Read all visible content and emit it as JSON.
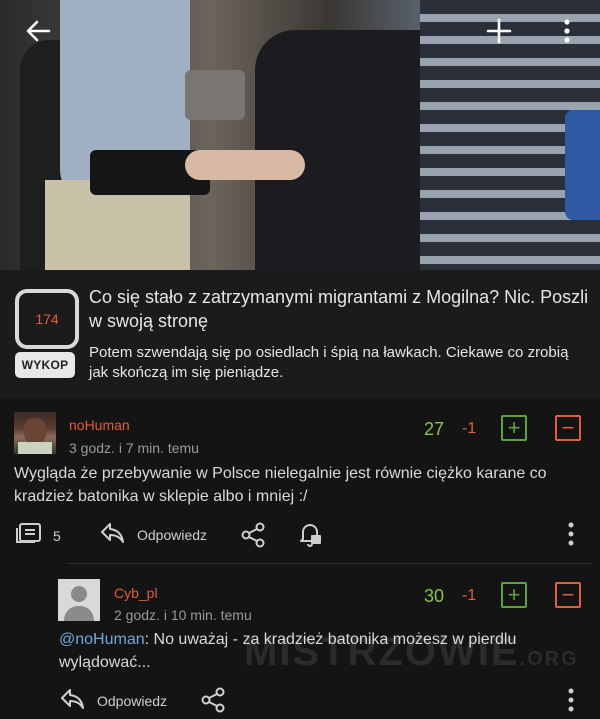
{
  "post": {
    "score": "174",
    "source_badge": "WYKOP",
    "title": "Co się stało z zatrzymanymi migrantami z Mogilna? Nic. Poszli w swoją stronę",
    "description": "Potem szwendają się po osiedlach i śpią na ławkach. Ciekawe co zrobią jak skończą im się pieniądze."
  },
  "comments": [
    {
      "author": "noHuman",
      "time": "3 godz. i 7 min. temu",
      "upvotes": "27",
      "downvotes": "-1",
      "body": "Wygląda że przebywanie w Polsce nielegalnie jest równie ciężko karane co kradzież batonika w sklepie albo i mniej :/",
      "reply_count": "5",
      "reply_label": "Odpowiedz"
    },
    {
      "author": "Cyb_pl",
      "time": "2 godz. i 10 min. temu",
      "upvotes": "30",
      "downvotes": "-1",
      "mention": "@noHuman",
      "body": ": No uważaj - za kradzież batonika możesz w pierdlu wylądować...",
      "reply_label": "Odpowiedz"
    }
  ],
  "watermark": {
    "main": "MISTRZOWIE",
    "suffix": ".ORG"
  },
  "colors": {
    "accent": "#e35d3a",
    "upvote": "#8bc34a",
    "link": "#6fa8dc",
    "background": "#141414"
  },
  "icons": [
    "back-arrow-icon",
    "plus-icon",
    "more-vertical-icon",
    "comments-icon",
    "reply-icon",
    "share-icon",
    "bell-icon"
  ]
}
